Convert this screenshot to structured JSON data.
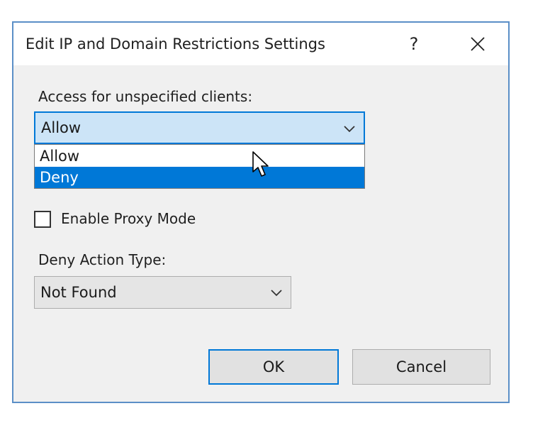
{
  "dialog": {
    "title": "Edit IP and Domain Restrictions Settings",
    "help_label": "?",
    "close_label": "✕"
  },
  "access": {
    "label": "Access for unspecified clients:",
    "selected": "Allow",
    "options": [
      "Allow",
      "Deny"
    ],
    "highlighted": "Deny"
  },
  "proxy": {
    "label": "Enable Proxy Mode",
    "checked": false
  },
  "deny_action": {
    "label": "Deny Action Type:",
    "selected": "Not Found"
  },
  "buttons": {
    "ok": "OK",
    "cancel": "Cancel"
  },
  "colors": {
    "accent": "#0078d7",
    "selected_field_bg": "#cce4f7",
    "dialog_border": "#5b8fc7"
  }
}
